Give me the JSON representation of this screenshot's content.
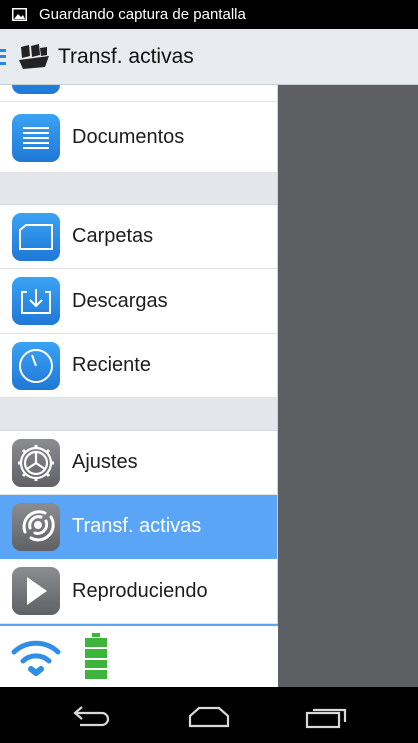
{
  "status_bar": {
    "notification_text": "Guardando captura de pantalla",
    "icon": "image-icon"
  },
  "action_bar": {
    "title": "Transf. activas",
    "menu_icon": "drawer-indicator-icon",
    "app_icon": "ship-logo-icon"
  },
  "drawer": {
    "items": [
      {
        "label": "",
        "icon": "photos-icon"
      },
      {
        "label": "Documentos",
        "icon": "documents-icon"
      },
      {
        "label": "Carpetas",
        "icon": "folder-icon"
      },
      {
        "label": "Descargas",
        "icon": "download-tray-icon"
      },
      {
        "label": "Reciente",
        "icon": "clock-icon"
      },
      {
        "label": "Ajustes",
        "icon": "gear-icon"
      },
      {
        "label": "Transf. activas",
        "icon": "transfers-icon",
        "active": true
      },
      {
        "label": "Reproduciendo",
        "icon": "play-icon"
      }
    ],
    "footer": {
      "wifi_icon": "wifi-icon",
      "battery_icon": "battery-icon"
    }
  },
  "nav_bar": {
    "back_icon": "back-icon",
    "home_icon": "home-icon",
    "recents_icon": "recent-apps-icon"
  },
  "colors": {
    "accent": "#5aa5f5",
    "icon_blue": "#2f8ee6",
    "icon_gray": "#707276",
    "battery_green": "#3db53d",
    "overlay": "#5d5f63"
  }
}
